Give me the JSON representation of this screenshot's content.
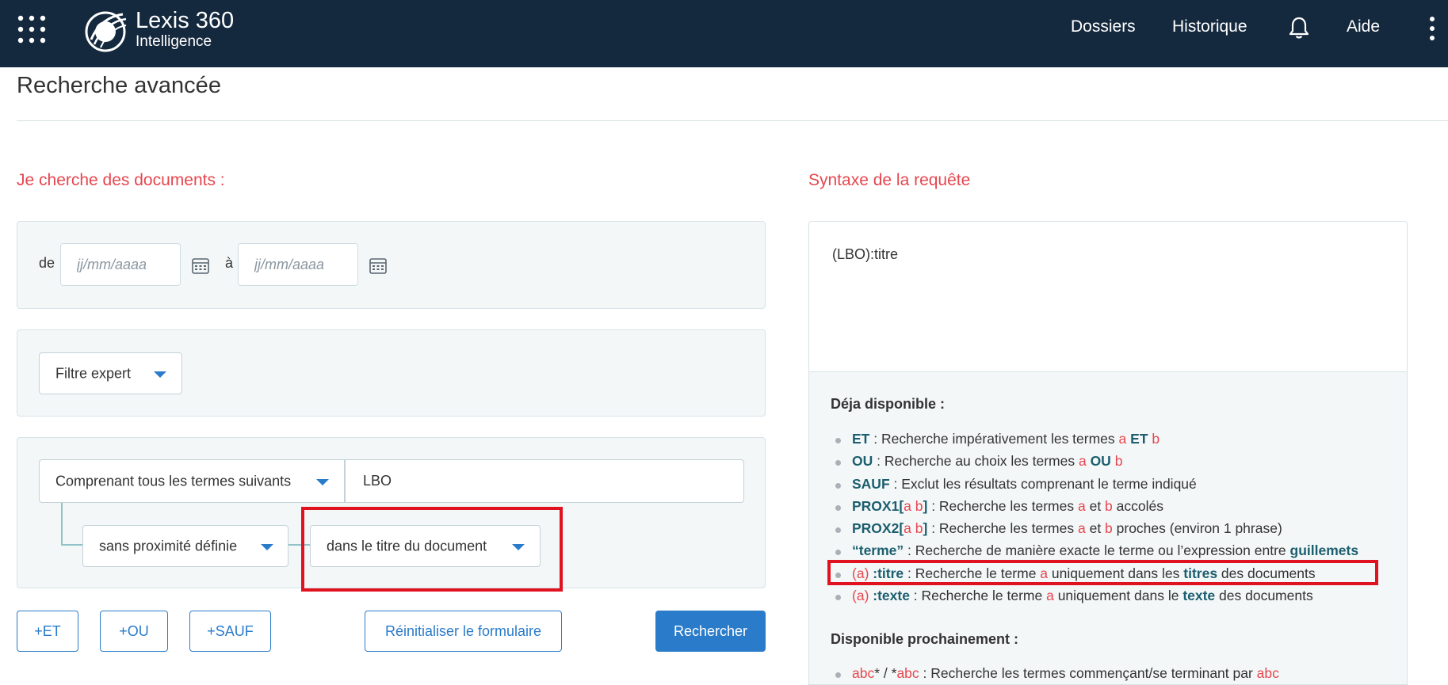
{
  "header": {
    "logo_brand": "Lexis 360",
    "logo_subtitle": "Intelligence",
    "nav": {
      "dossiers": "Dossiers",
      "historique": "Historique",
      "aide": "Aide"
    }
  },
  "page": {
    "title": "Recherche avancée"
  },
  "search_form": {
    "heading": "Je cherche des documents :",
    "date_range": {
      "from_label": "de",
      "from_placeholder": "jj/mm/aaaa",
      "from_value": "",
      "to_label": "à",
      "to_placeholder": "jj/mm/aaaa",
      "to_value": ""
    },
    "filter_select": "Filtre expert",
    "term_mode_select": "Comprenant tous les termes suivants",
    "term_value": "LBO",
    "proximity_select": "sans proximité définie",
    "scope_select": "dans le titre du document",
    "buttons": {
      "and": "+ET",
      "or": "+OU",
      "not": "+SAUF",
      "reset": "Réinitialiser le formulaire",
      "search": "Rechercher"
    }
  },
  "syntax": {
    "heading": "Syntaxe de la requête",
    "query": "(LBO):titre",
    "available_title": "Déja disponible :",
    "available": [
      {
        "kw": "ET",
        "pre": "",
        "mid": " : Recherche impérativement les termes ",
        "a": "a",
        "op": "ET",
        "b": "b"
      },
      {
        "kw": "OU",
        "mid": " : Recherche au choix les termes ",
        "a": "a",
        "op": "OU",
        "b": "b"
      },
      {
        "kw": "SAUF",
        "mid": " : Exclut les résultats comprenant le terme indiqué"
      },
      {
        "kw": "PROX1[",
        "a": "a",
        "b": "b",
        "kw_end": "]",
        "mid": " : Recherche les termes ",
        "tail": " accolés"
      },
      {
        "kw": "PROX2[",
        "a": "a",
        "b": "b",
        "kw_end": "]",
        "mid": " : Recherche les termes ",
        "tail": " proches (environ 1 phrase)"
      },
      {
        "kw": "“terme”",
        "mid": " : Recherche de manière exacte le terme ou l’expression entre ",
        "op": "guillemets"
      },
      {
        "open": "(",
        "a": "a",
        "close": ")",
        "kw": " :titre",
        "mid": " : Recherche le terme ",
        "mid2": " uniquement dans les ",
        "op": "titres",
        "tail": " des documents"
      },
      {
        "open": "(",
        "a": "a",
        "close": ")",
        "kw": " :texte",
        "mid": " : Recherche le terme ",
        "mid2": " uniquement dans le ",
        "op": "texte",
        "tail": " des documents"
      }
    ],
    "upcoming_title": "Disponible prochainement :",
    "upcoming": [
      {
        "a1": "abc",
        "sep": "* / *",
        "a2": "abc",
        "mid": " : Recherche les termes commençant/se terminant par ",
        "a3": "abc"
      }
    ]
  },
  "colors": {
    "header_bg": "#15293e",
    "accent_red": "#e6474f",
    "primary_blue": "#2a7bc9",
    "keyword_teal": "#1c5e6e",
    "highlight_red": "#e0121f"
  },
  "icons": [
    "apps-grid-icon",
    "lexis-logo-icon",
    "bell-icon",
    "kebab-menu-icon",
    "calendar-icon",
    "chevron-down-icon"
  ]
}
